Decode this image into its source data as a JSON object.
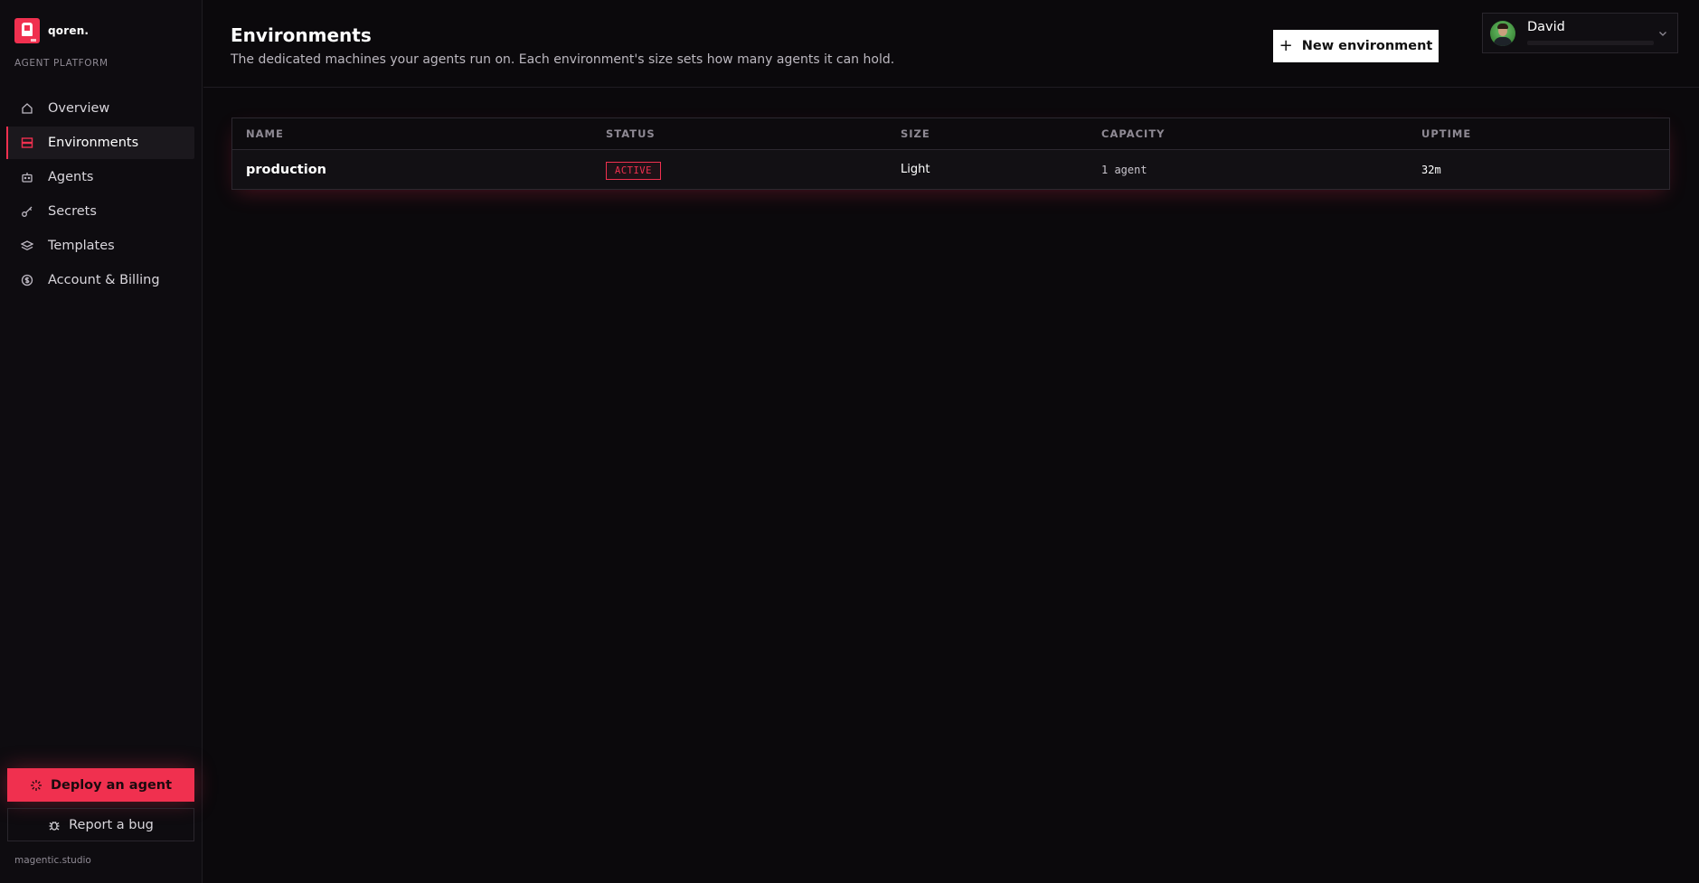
{
  "brand": {
    "name": "qoren.",
    "platform_label": "AGENT PLATFORM",
    "accent": "#f0304f"
  },
  "sidebar": {
    "items": [
      {
        "label": "Overview",
        "icon": "home-icon",
        "active": false
      },
      {
        "label": "Environments",
        "icon": "server-icon",
        "active": true
      },
      {
        "label": "Agents",
        "icon": "robot-icon",
        "active": false
      },
      {
        "label": "Secrets",
        "icon": "key-icon",
        "active": false
      },
      {
        "label": "Templates",
        "icon": "layers-icon",
        "active": false
      },
      {
        "label": "Account & Billing",
        "icon": "dollar-icon",
        "active": false
      }
    ],
    "deploy_label": "Deploy an agent",
    "bug_label": "Report a bug",
    "footer": "magentic.studio"
  },
  "header": {
    "title": "Environments",
    "subtitle": "The dedicated machines your agents run on. Each environment's size sets how many agents it can hold.",
    "new_button_label": "New environment"
  },
  "user": {
    "name": "David"
  },
  "table": {
    "columns": [
      "NAME",
      "STATUS",
      "SIZE",
      "CAPACITY",
      "UPTIME"
    ],
    "rows": [
      {
        "name": "production",
        "status": "ACTIVE",
        "size": "Light",
        "capacity": "1 agent",
        "uptime": "32m"
      }
    ]
  }
}
